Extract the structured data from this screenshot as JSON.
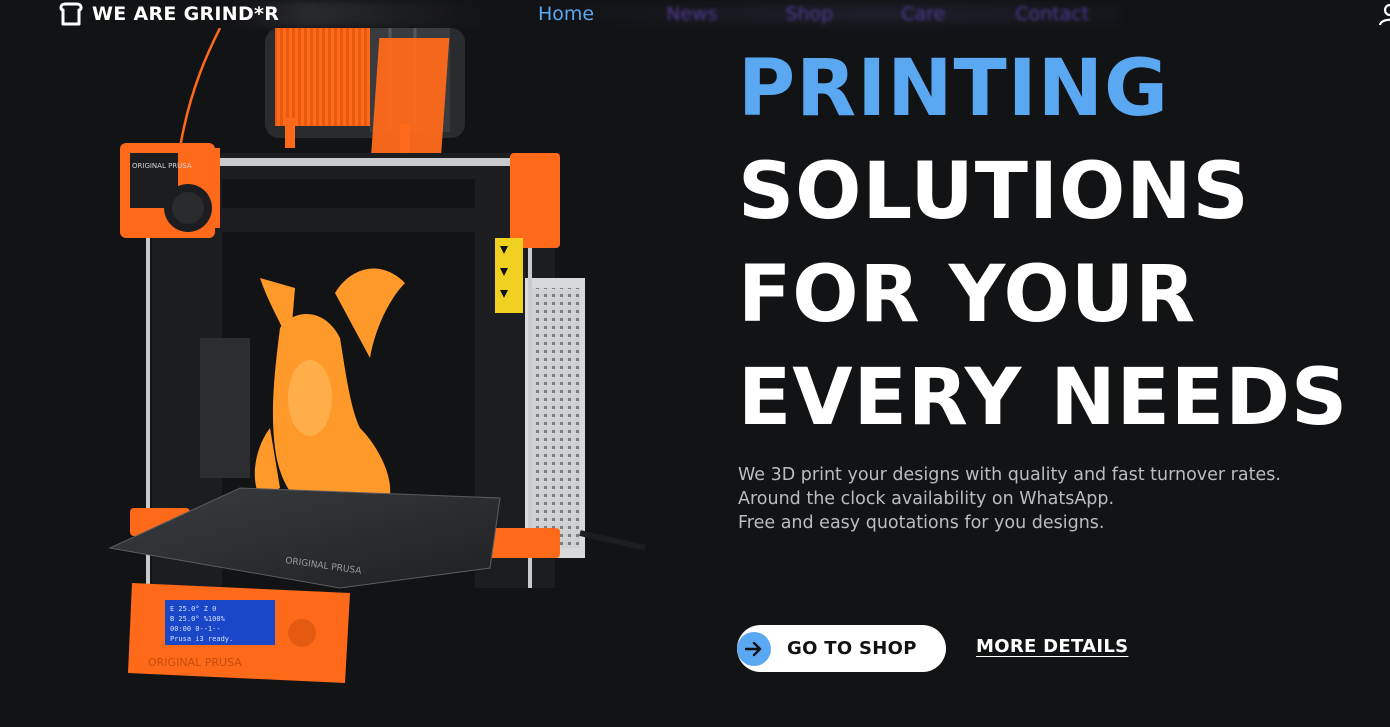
{
  "header": {
    "brand": "WE ARE GRIND*R",
    "nav": [
      {
        "label": "Home"
      },
      {
        "label": "News"
      },
      {
        "label": "Shop"
      },
      {
        "label": "Care"
      },
      {
        "label": "Contact"
      }
    ]
  },
  "hero": {
    "lines": [
      "PRINTING",
      "SOLUTIONS",
      "FOR YOUR",
      "EVERY NEEDS"
    ],
    "description": [
      "We 3D print your designs with quality and fast turnover rates.",
      "Around the clock availability on WhatsApp.",
      "Free and easy quotations for you designs."
    ],
    "cta_primary": "GO TO SHOP",
    "cta_secondary": "MORE DETAILS"
  },
  "printer": {
    "brand_text": "ORIGINAL PRUSA",
    "bed_text": "ORIGINAL PRUSA",
    "screen_lines": [
      "E 25.0°    Z 0",
      "B 25.0°   %100%",
      "00:00      0--1--",
      "Prusa i3 ready."
    ]
  },
  "colors": {
    "background": "#121315",
    "accent": "#5aa8f2",
    "printer_orange": "#ff6a1a",
    "dragon_orange": "#ff9a2a"
  },
  "icons": {
    "brand": "toast-icon",
    "user": "user-icon",
    "cta": "arrow-right-icon"
  }
}
